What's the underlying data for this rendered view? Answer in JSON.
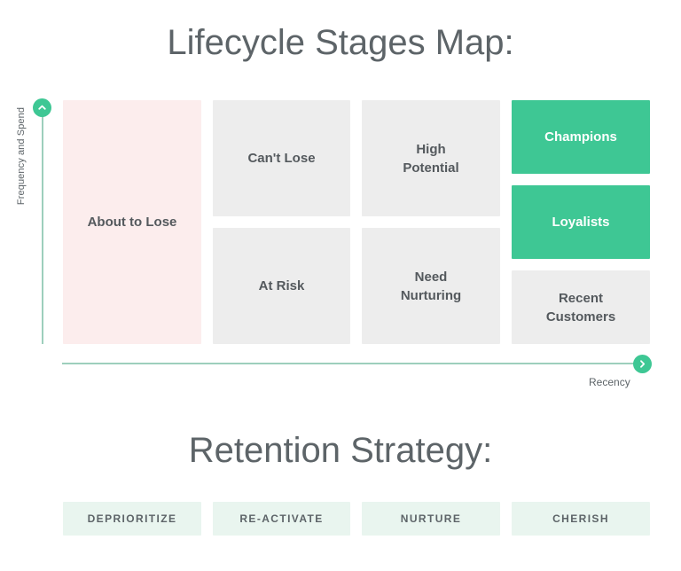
{
  "headings": {
    "lifecycle": "Lifecycle Stages Map:",
    "retention": "Retention Strategy:"
  },
  "axes": {
    "y_label": "Frequency and Spend",
    "x_label": "Recency",
    "y_marker_icon": "chevron-up-icon",
    "x_marker_icon": "chevron-right-icon",
    "line_color": "#9dcfbc",
    "marker_color": "#3ec794"
  },
  "colors": {
    "green": "#3ec794",
    "gray": "#ededed",
    "pink": "#fceded",
    "mint": "#e9f5ef",
    "text": "#5d6468"
  },
  "matrix": {
    "columns": [
      {
        "name": "column-deprioritize",
        "cells": [
          {
            "label": "About to Lose",
            "style": "pink",
            "size": "full"
          }
        ]
      },
      {
        "name": "column-reactivate",
        "cells": [
          {
            "label": "Can't Lose",
            "style": "gray",
            "size": "half"
          },
          {
            "label": "At Risk",
            "style": "gray",
            "size": "half"
          }
        ]
      },
      {
        "name": "column-nurture",
        "cells": [
          {
            "label": "High\nPotential",
            "line1": "High",
            "line2": "Potential",
            "style": "gray",
            "size": "half"
          },
          {
            "label": "Need\nNurturing",
            "line1": "Need",
            "line2": "Nurturing",
            "style": "gray",
            "size": "half"
          }
        ]
      },
      {
        "name": "column-cherish",
        "cells": [
          {
            "label": "Champions",
            "style": "green",
            "size": "third"
          },
          {
            "label": "Loyalists",
            "style": "green",
            "size": "third"
          },
          {
            "label": "Recent\nCustomers",
            "line1": "Recent",
            "line2": "Customers",
            "style": "gray",
            "size": "third"
          }
        ]
      }
    ]
  },
  "strategy": {
    "chips": [
      {
        "label": "DEPRIORITIZE"
      },
      {
        "label": "RE-ACTIVATE"
      },
      {
        "label": "NURTURE"
      },
      {
        "label": "CHERISH"
      }
    ]
  }
}
